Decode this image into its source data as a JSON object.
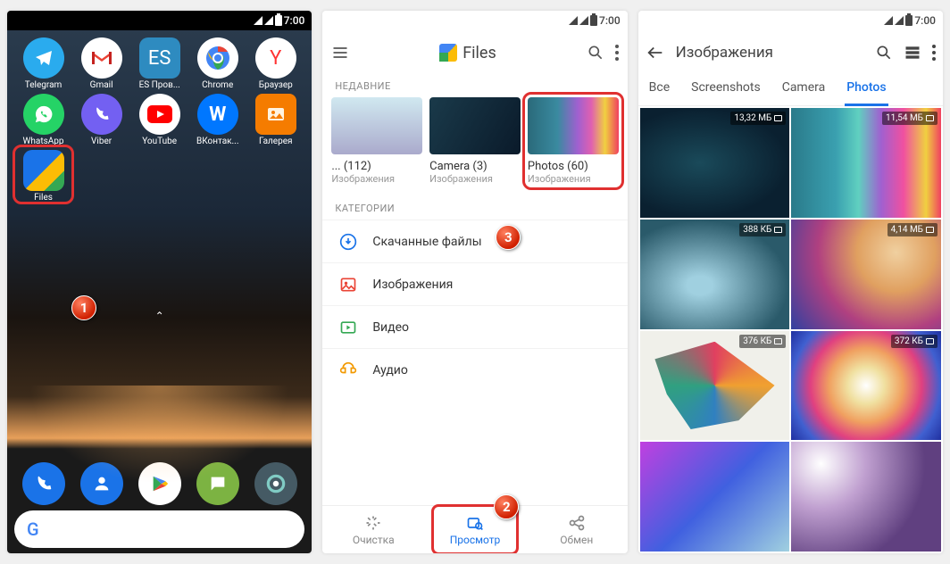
{
  "status": {
    "time": "7:00"
  },
  "badges": {
    "one": "1",
    "two": "2",
    "three": "3"
  },
  "home": {
    "apps_r1": [
      {
        "name": "Telegram",
        "color": "#2AABEE"
      },
      {
        "name": "Gmail",
        "color": "#fff"
      },
      {
        "name": "ES Пров...",
        "color": "#2E8BC0"
      },
      {
        "name": "Chrome",
        "color": "#fff"
      },
      {
        "name": "Браузер",
        "color": "#fff"
      }
    ],
    "apps_r2": [
      {
        "name": "WhatsApp",
        "color": "#25D366"
      },
      {
        "name": "Viber",
        "color": "#7360F2"
      },
      {
        "name": "YouTube",
        "color": "#fff"
      },
      {
        "name": "ВКонтак...",
        "color": "#0077FF"
      },
      {
        "name": "Галерея",
        "color": "#F57C00"
      }
    ],
    "files_app": "Files",
    "google": "G"
  },
  "files": {
    "title": "Files",
    "recent_header": "НЕДАВНИЕ",
    "recent": [
      {
        "title": "... (112)",
        "sub": "Изображения"
      },
      {
        "title": "Camera (3)",
        "sub": "Изображения"
      },
      {
        "title": "Photos (60)",
        "sub": "Изображения"
      }
    ],
    "cat_header": "КАТЕГОРИИ",
    "cats": [
      {
        "label": "Скачанные файлы",
        "color": "#1a73e8"
      },
      {
        "label": "Изображения",
        "color": "#ea4335"
      },
      {
        "label": "Видео",
        "color": "#34a853"
      },
      {
        "label": "Аудио",
        "color": "#f29900"
      }
    ],
    "bottom": {
      "clean": "Очистка",
      "browse": "Просмотр",
      "share": "Обмен"
    }
  },
  "gallery": {
    "title": "Изображения",
    "tabs": {
      "all": "Все",
      "screenshots": "Screenshots",
      "camera": "Camera",
      "photos": "Photos"
    },
    "sizes": [
      "13,32 МБ",
      "11,54 МБ",
      "388 КБ",
      "4,14 МБ",
      "376 КБ",
      "372 КБ"
    ]
  }
}
